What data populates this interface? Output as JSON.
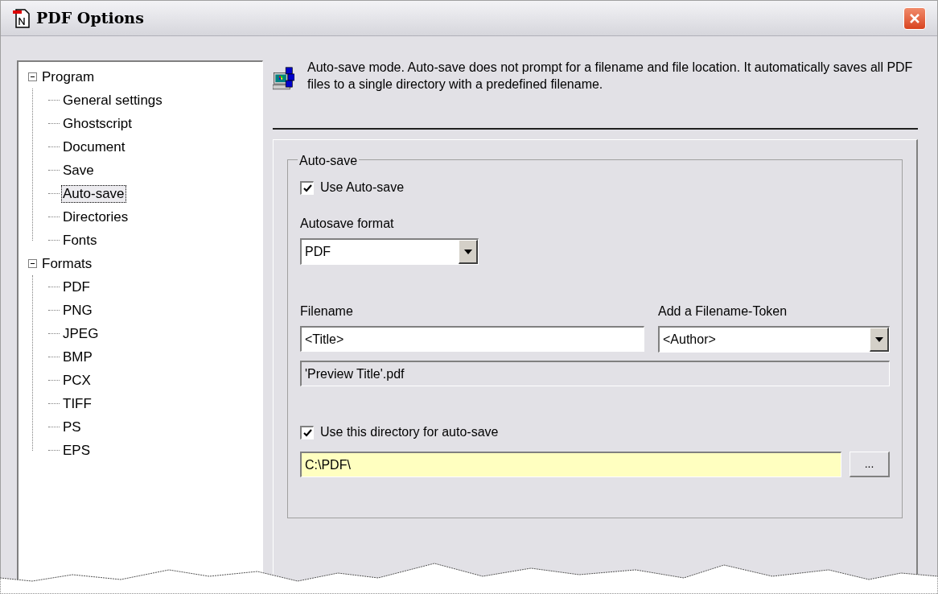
{
  "window": {
    "title": "PDF Options"
  },
  "tree": [
    {
      "label": "Program",
      "expanded": true,
      "selected": false,
      "children": [
        {
          "label": "General settings",
          "selected": false
        },
        {
          "label": "Ghostscript",
          "selected": false
        },
        {
          "label": "Document",
          "selected": false
        },
        {
          "label": "Save",
          "selected": false
        },
        {
          "label": "Auto-save",
          "selected": true
        },
        {
          "label": "Directories",
          "selected": false
        },
        {
          "label": "Fonts",
          "selected": false
        }
      ]
    },
    {
      "label": "Formats",
      "expanded": true,
      "selected": false,
      "children": [
        {
          "label": "PDF",
          "selected": false
        },
        {
          "label": "PNG",
          "selected": false
        },
        {
          "label": "JPEG",
          "selected": false
        },
        {
          "label": "BMP",
          "selected": false
        },
        {
          "label": "PCX",
          "selected": false
        },
        {
          "label": "TIFF",
          "selected": false
        },
        {
          "label": "PS",
          "selected": false
        },
        {
          "label": "EPS",
          "selected": false
        }
      ]
    }
  ],
  "description": "Auto-save mode. Auto-save does not prompt for a filename and file location. It automatically saves all PDF files to a single directory with a predefined filename.",
  "group": {
    "title": "Auto-save",
    "use_autosave": {
      "label": "Use Auto-save",
      "checked": true
    },
    "format": {
      "label": "Autosave format",
      "value": "PDF"
    },
    "filename": {
      "label": "Filename",
      "value": "<Title>"
    },
    "token": {
      "label": "Add a Filename-Token",
      "value": "<Author>"
    },
    "preview": "'Preview Title'.pdf",
    "use_directory": {
      "label": "Use this directory for auto-save",
      "checked": true
    },
    "directory": {
      "value": "C:\\PDF\\"
    },
    "browse_button": "..."
  }
}
